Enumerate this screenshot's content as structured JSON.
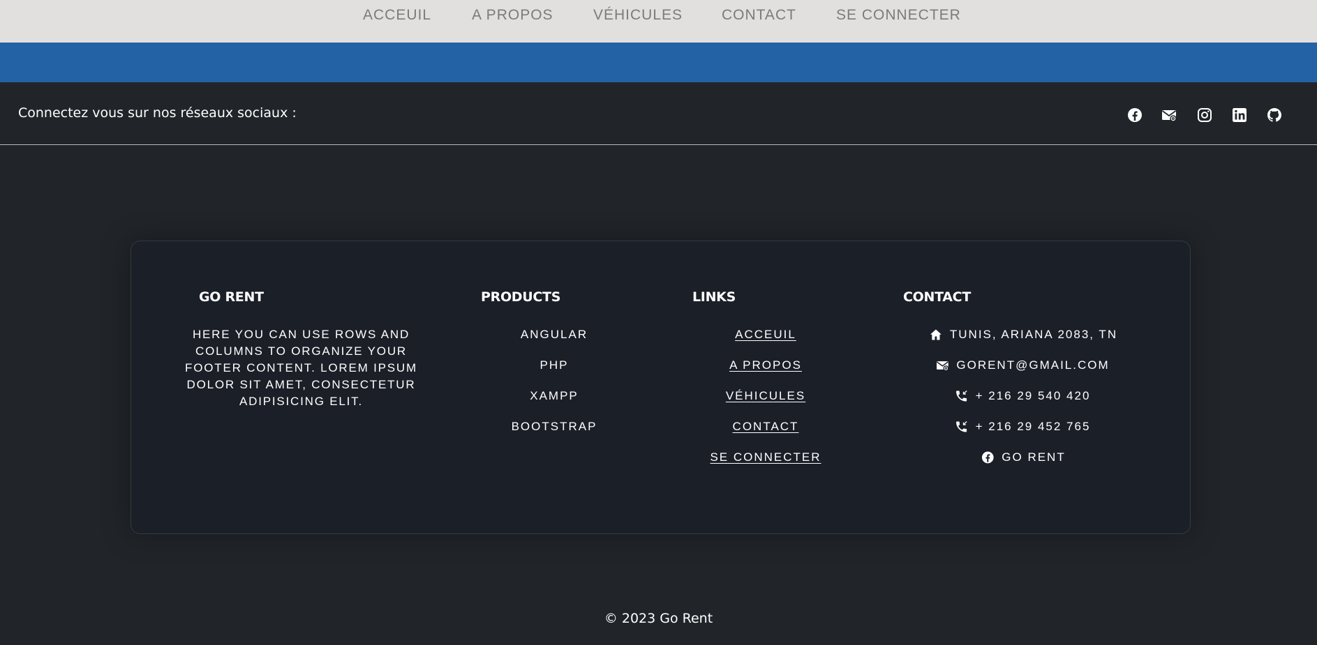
{
  "nav": {
    "items": [
      "ACCEUIL",
      "A PROPOS",
      "VÉHICULES",
      "CONTACT",
      "SE CONNECTER"
    ]
  },
  "social": {
    "text": "Connectez vous sur nos réseaux sociaux :",
    "icons": [
      "facebook-icon",
      "mail-icon",
      "instagram-icon",
      "linkedin-icon",
      "github-icon"
    ]
  },
  "footer": {
    "brand": {
      "title": "GO RENT",
      "description": "HERE YOU CAN USE ROWS AND COLUMNS TO ORGANIZE YOUR FOOTER CONTENT. LOREM IPSUM DOLOR SIT AMET, CONSECTETUR ADIPISICING ELIT."
    },
    "products": {
      "title": "PRODUCTS",
      "items": [
        "ANGULAR",
        "PHP",
        "XAMPP",
        "BOOTSTRAP"
      ]
    },
    "links": {
      "title": "LINKS",
      "items": [
        "ACCEUIL",
        "A PROPOS",
        "VÉHICULES",
        "CONTACT",
        "SE CONNECTER"
      ]
    },
    "contact": {
      "title": "CONTACT",
      "items": [
        {
          "icon": "home-icon",
          "text": "TUNIS, ARIANA 2083, TN"
        },
        {
          "icon": "mail-icon",
          "text": "GORENT@GMAIL.COM"
        },
        {
          "icon": "phone-icon",
          "text": "+ 216 29 540 420"
        },
        {
          "icon": "phone-icon",
          "text": "+ 216 29 452 765"
        },
        {
          "icon": "facebook-icon",
          "text": "GO RENT"
        }
      ]
    }
  },
  "copyright": "© 2023 Go Rent",
  "colors": {
    "nav_bg": "#e1e0de",
    "nav_text": "#7b7b7b",
    "accent_blue": "#2462a6",
    "page_bg": "#212529",
    "card_bg": "#1b1f28"
  }
}
